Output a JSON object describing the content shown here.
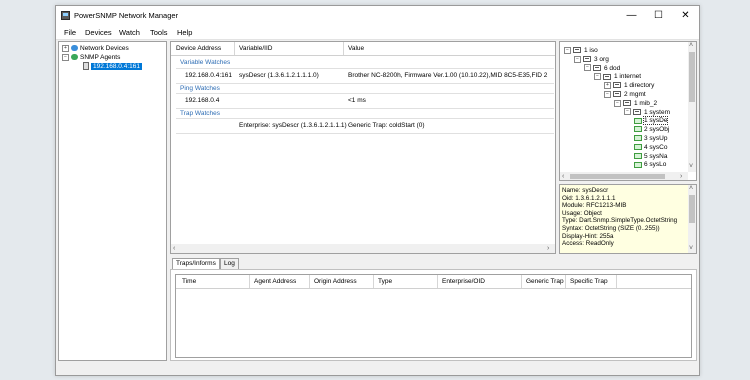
{
  "window": {
    "title": "PowerSNMP Network Manager",
    "minimize": "—",
    "maximize": "☐",
    "close": "✕"
  },
  "menu": [
    "File",
    "Devices",
    "Watch",
    "Tools",
    "Help"
  ],
  "device_tree": {
    "network_devices": "Network Devices",
    "snmp_agents": "SNMP Agents",
    "selected_agent": "192.168.0.4:161"
  },
  "watch_table": {
    "headers": [
      "Device Address",
      "Variable/IID",
      "Value"
    ],
    "sections": {
      "variable": "Variable Watches",
      "ping": "Ping Watches",
      "trap": "Trap Watches"
    },
    "variable_row": [
      "192.168.0.4:161",
      "sysDescr (1.3.6.1.2.1.1.1.0)",
      "Brother NC-8200h, Firmware Ver.1.00  (10.10.22),MID 8C5-E35,FID 2"
    ],
    "ping_row": [
      "192.168.0.4",
      "",
      "<1 ms"
    ],
    "trap_row": [
      "",
      "Enterprise: sysDescr (1.3.6.1.2.1.1.1)",
      "Generic Trap: coldStart (0)"
    ]
  },
  "mib_tree": [
    "1 iso",
    "3 org",
    "6 dod",
    "1 internet",
    "1 directory",
    "2 mgmt",
    "1 mib_2",
    "1 system",
    "1 sysDe",
    "2 sysObj",
    "3 sysUp",
    "4 sysCo",
    "5 sysNa",
    "6 sysLo"
  ],
  "mib_info": [
    "Name: sysDescr",
    "Oid: 1.3.6.1.2.1.1.1",
    "Module: RFC1213-MIB",
    "Usage: Object",
    "Type: Dart.Snmp.SimpleType.OctetString",
    "Syntax: OctetString (SIZE (0..255))",
    "Display-Hint: 255a",
    "Access: ReadOnly"
  ],
  "bottom_tabs": [
    "Traps/Informs",
    "Log"
  ],
  "trap_table_headers": [
    "Time",
    "Agent Address",
    "Origin Address",
    "Type",
    "Enterprise/OID",
    "Generic Trap",
    "Specific Trap"
  ]
}
